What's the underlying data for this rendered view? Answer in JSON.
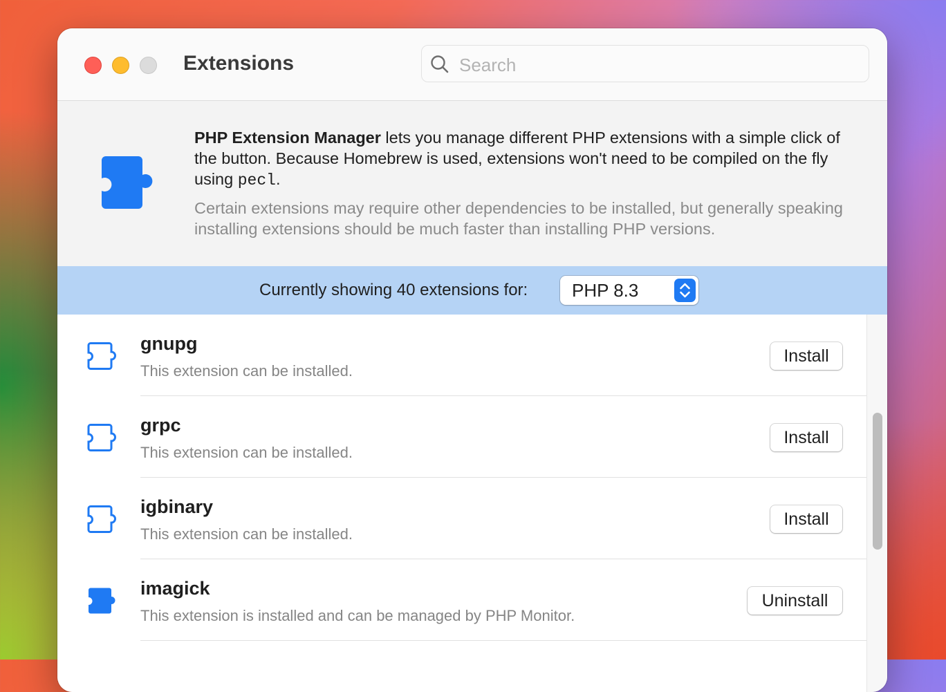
{
  "window": {
    "title": "Extensions"
  },
  "search": {
    "placeholder": "Search",
    "value": ""
  },
  "info": {
    "bold_lead": "PHP Extension Manager",
    "text_part1": " lets you manage different PHP extensions with a simple click of the button. Because Homebrew is used, extensions won't need to be compiled on the fly using ",
    "code": "pecl",
    "text_part2": ".",
    "muted": "Certain extensions may require other dependencies to be installed, but generally speaking installing extensions should be much faster than installing PHP versions."
  },
  "filter_bar": {
    "label": "Currently showing 40 extensions for:",
    "selected_version": "PHP 8.3"
  },
  "extensions": [
    {
      "name": "gnupg",
      "description": "This extension can be installed.",
      "action": "Install",
      "installed": false
    },
    {
      "name": "grpc",
      "description": "This extension can be installed.",
      "action": "Install",
      "installed": false
    },
    {
      "name": "igbinary",
      "description": "This extension can be installed.",
      "action": "Install",
      "installed": false
    },
    {
      "name": "imagick",
      "description": "This extension is installed and can be managed by PHP Monitor.",
      "action": "Uninstall",
      "installed": true
    }
  ],
  "colors": {
    "accent": "#1f7af3",
    "filter_bar": "#b5d3f5"
  },
  "icons": {
    "extension": "puzzle-piece-icon",
    "search": "magnifying-glass-icon"
  }
}
